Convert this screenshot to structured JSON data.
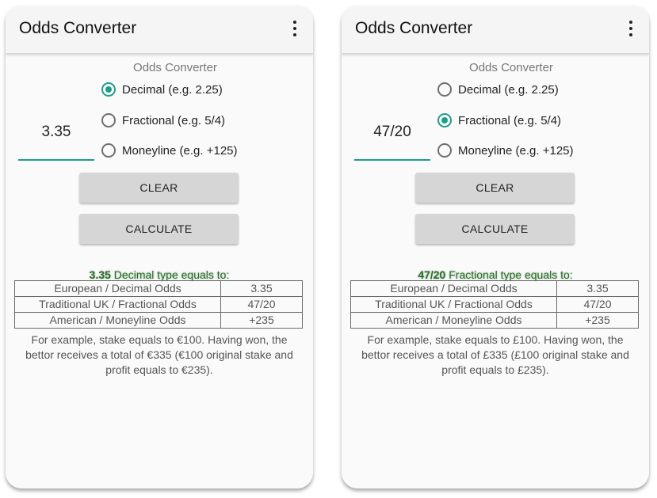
{
  "screens": [
    {
      "app_title": "Odds Converter",
      "subtitle": "Odds Converter",
      "input_value": "3.35",
      "radio_options": [
        {
          "label": "Decimal (e.g. 2.25)",
          "checked": true
        },
        {
          "label": "Fractional (e.g. 5/4)",
          "checked": false
        },
        {
          "label": "Moneyline (e.g. +125)",
          "checked": false
        }
      ],
      "clear_label": "CLEAR",
      "calculate_label": "CALCULATE",
      "result_value": "3.35",
      "result_suffix": " Decimal type equals to:",
      "table": [
        {
          "label": "European / Decimal Odds",
          "value": "3.35"
        },
        {
          "label": "Traditional UK / Fractional Odds",
          "value": "47/20"
        },
        {
          "label": "American / Moneyline Odds",
          "value": "+235"
        }
      ],
      "example": "For example, stake equals to €100. Having won, the bettor receives a total of €335 (€100 original stake and profit equals to €235)."
    },
    {
      "app_title": "Odds Converter",
      "subtitle": "Odds Converter",
      "input_value": "47/20",
      "radio_options": [
        {
          "label": "Decimal (e.g. 2.25)",
          "checked": false
        },
        {
          "label": "Fractional (e.g. 5/4)",
          "checked": true
        },
        {
          "label": "Moneyline (e.g. +125)",
          "checked": false
        }
      ],
      "clear_label": "CLEAR",
      "calculate_label": "CALCULATE",
      "result_value": "47/20",
      "result_suffix": " Fractional type equals to:",
      "table": [
        {
          "label": "European / Decimal Odds",
          "value": "3.35"
        },
        {
          "label": "Traditional UK / Fractional Odds",
          "value": "47/20"
        },
        {
          "label": "American / Moneyline Odds",
          "value": "+235"
        }
      ],
      "example": "For example, stake equals to £100. Having won, the bettor receives a total of £335 (£100 original stake and profit equals to £235)."
    }
  ],
  "icons": {
    "menu": "more-vert-icon"
  },
  "colors": {
    "accent": "#1e9e8a",
    "result_title": "#2e6b2e"
  }
}
